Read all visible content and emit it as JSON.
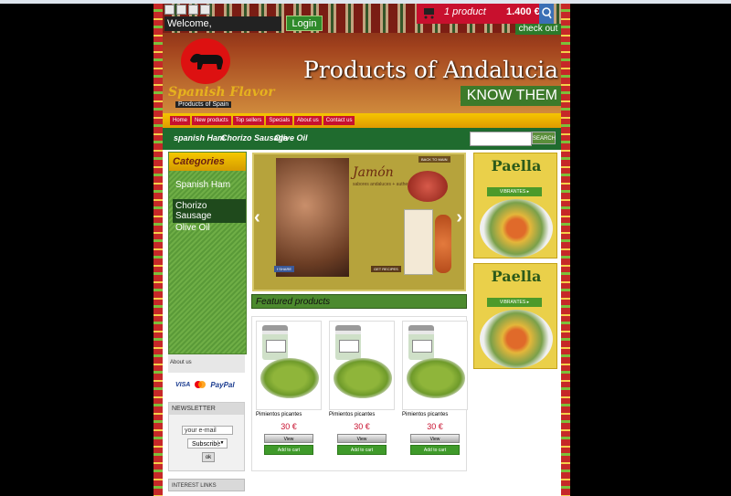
{
  "header": {
    "welcome_label": "Welcome,",
    "login_label": "Login",
    "cart_count": "1 product",
    "cart_total": "1.400 €",
    "checkout_label": "check out",
    "logo_text": "Spanish Flavor",
    "logo_sub": "Products of Spain",
    "banner_title": "Products of Andalucia",
    "banner_cta": "KNOW THEM"
  },
  "nav": {
    "tabs": [
      "Home",
      "New products",
      "Top sellers",
      "Specials",
      "About us",
      "Contact us"
    ]
  },
  "category_bar": {
    "links": [
      "spanish Ham",
      "Chorizo Sausage",
      "Olive Oil"
    ],
    "search_button": "SEARCH"
  },
  "sidebar": {
    "heading": "Categories",
    "items": [
      {
        "label": "Spanish Ham"
      },
      {
        "label": "Chorizo Sausage"
      },
      {
        "label": "Olive Oil"
      }
    ],
    "about_label": "About us",
    "payments": [
      "VISA",
      "PayPal"
    ],
    "newsletter": {
      "heading": "NEWSLETTER",
      "email_placeholder": "your e-mail",
      "select_value": "Subscribe",
      "ok_label": "ok"
    },
    "interest_links": "INTEREST LINKS"
  },
  "slider": {
    "title": "Jamón",
    "subtitle": "sabores andaluces + authentic flavors",
    "back_label": "BACK TO MAIN",
    "recipes_label": "GET RECIPES",
    "like_label": "f SHARE"
  },
  "featured": {
    "heading": "Featured products",
    "products": [
      {
        "name": "Pimientos picantes",
        "price": "30 €",
        "view": "View",
        "add": "Add to cart"
      },
      {
        "name": "Pimientos picantes",
        "price": "30 €",
        "view": "View",
        "add": "Add to cart"
      },
      {
        "name": "Pimientos picantes",
        "price": "30 €",
        "view": "View",
        "add": "Add to cart"
      }
    ]
  },
  "ads": [
    {
      "title": "Paella",
      "badge": "VIBRANTES ▸"
    },
    {
      "title": "Paella",
      "badge": "VIBRANTES ▸"
    }
  ],
  "colors": {
    "brand_red": "#c8102e",
    "brand_green": "#1f6b2e",
    "brand_yellow": "#f5c500"
  }
}
